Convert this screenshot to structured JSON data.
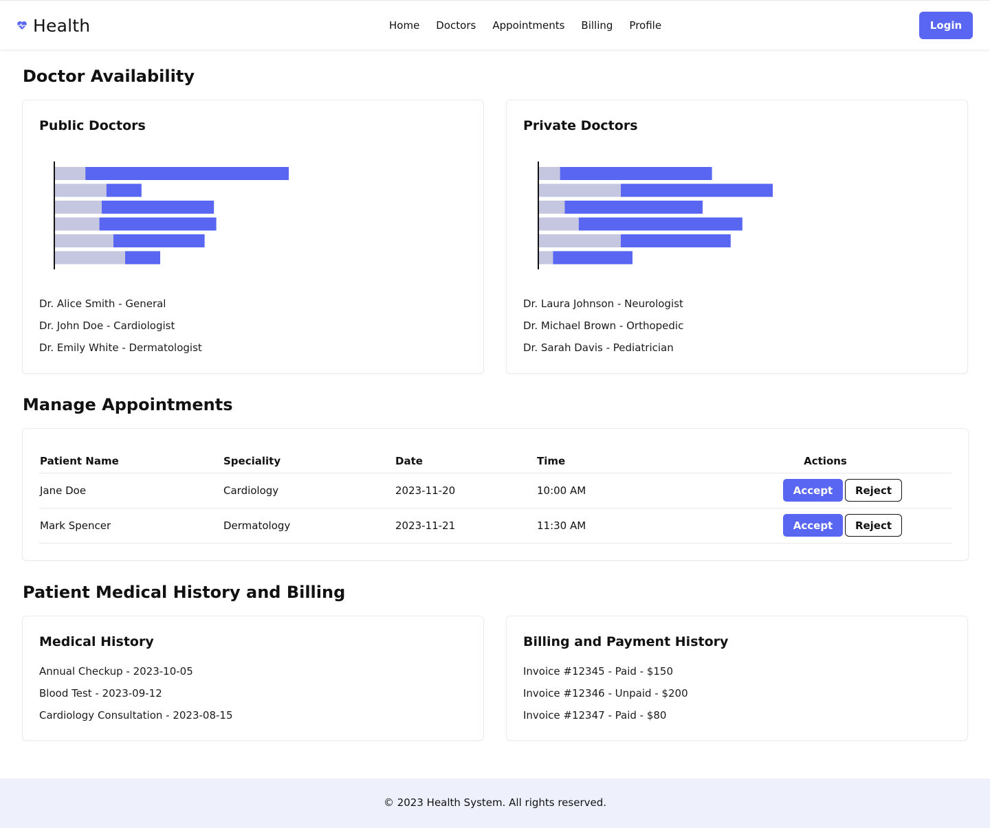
{
  "header": {
    "brand": "Health",
    "nav": [
      "Home",
      "Doctors",
      "Appointments",
      "Billing",
      "Profile"
    ],
    "login_label": "Login",
    "accent_color": "#5866f2"
  },
  "availability": {
    "title": "Doctor Availability",
    "public": {
      "title": "Public Doctors",
      "doctors": [
        "Dr. Alice Smith - General",
        "Dr. John Doe - Cardiologist",
        "Dr. Emily White - Dermatologist"
      ]
    },
    "private": {
      "title": "Private Doctors",
      "doctors": [
        "Dr. Laura Johnson - Neurologist",
        "Dr. Michael Brown - Orthopedic",
        "Dr. Sarah Davis - Pediatrician"
      ]
    }
  },
  "chart_data": [
    {
      "type": "bar",
      "orientation": "horizontal",
      "stacked": true,
      "title": "",
      "grid": false,
      "series": [
        {
          "color": "#c5c6e0",
          "values": [
            13,
            22,
            20,
            19,
            25,
            30
          ]
        },
        {
          "color": "#5866f2",
          "values": [
            87,
            15,
            48,
            50,
            39,
            15
          ]
        }
      ]
    },
    {
      "type": "bar",
      "orientation": "horizontal",
      "stacked": true,
      "title": "",
      "grid": false,
      "series": [
        {
          "color": "#c5c6e0",
          "values": [
            9,
            35,
            11,
            17,
            35,
            6
          ]
        },
        {
          "color": "#5866f2",
          "values": [
            65,
            65,
            59,
            70,
            47,
            34
          ]
        }
      ]
    }
  ],
  "appointments": {
    "title": "Manage Appointments",
    "columns": [
      "Patient Name",
      "Speciality",
      "Date",
      "Time",
      "Actions"
    ],
    "rows": [
      {
        "patient": "Jane Doe",
        "speciality": "Cardiology",
        "date": "2023-11-20",
        "time": "10:00 AM"
      },
      {
        "patient": "Mark Spencer",
        "speciality": "Dermatology",
        "date": "2023-11-21",
        "time": "11:30 AM"
      }
    ],
    "accept_label": "Accept",
    "reject_label": "Reject"
  },
  "history": {
    "title": "Patient Medical History and Billing",
    "medical": {
      "title": "Medical History",
      "items": [
        "Annual Checkup - 2023-10-05",
        "Blood Test - 2023-09-12",
        "Cardiology Consultation - 2023-08-15"
      ]
    },
    "billing": {
      "title": "Billing and Payment History",
      "items": [
        "Invoice #12345 - Paid - $150",
        "Invoice #12346 - Unpaid - $200",
        "Invoice #12347 - Paid - $80"
      ]
    }
  },
  "footer": {
    "text": "© 2023 Health System. All rights reserved."
  }
}
